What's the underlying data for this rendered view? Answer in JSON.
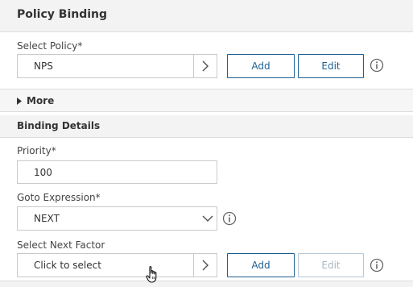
{
  "panel": {
    "title": "Policy Binding"
  },
  "select_policy": {
    "label": "Select Policy*",
    "value": "NPS",
    "add_label": "Add",
    "edit_label": "Edit"
  },
  "more": {
    "label": "More"
  },
  "binding_details": {
    "title": "Binding Details",
    "priority": {
      "label": "Priority*",
      "value": "100"
    },
    "goto_expression": {
      "label": "Goto Expression*",
      "value": "NEXT"
    },
    "next_factor": {
      "label": "Select Next Factor",
      "placeholder": "Click to select",
      "add_label": "Add",
      "edit_label": "Edit"
    }
  },
  "colors": {
    "accent": "#1d5f92",
    "disabled": "#a7b8c7",
    "header_bg": "#f3f3f3",
    "border": "#c9c9c9"
  },
  "icons": [
    "chevron-right-icon",
    "info-icon",
    "caret-right-icon",
    "chevron-down-icon",
    "hand-cursor-icon"
  ]
}
